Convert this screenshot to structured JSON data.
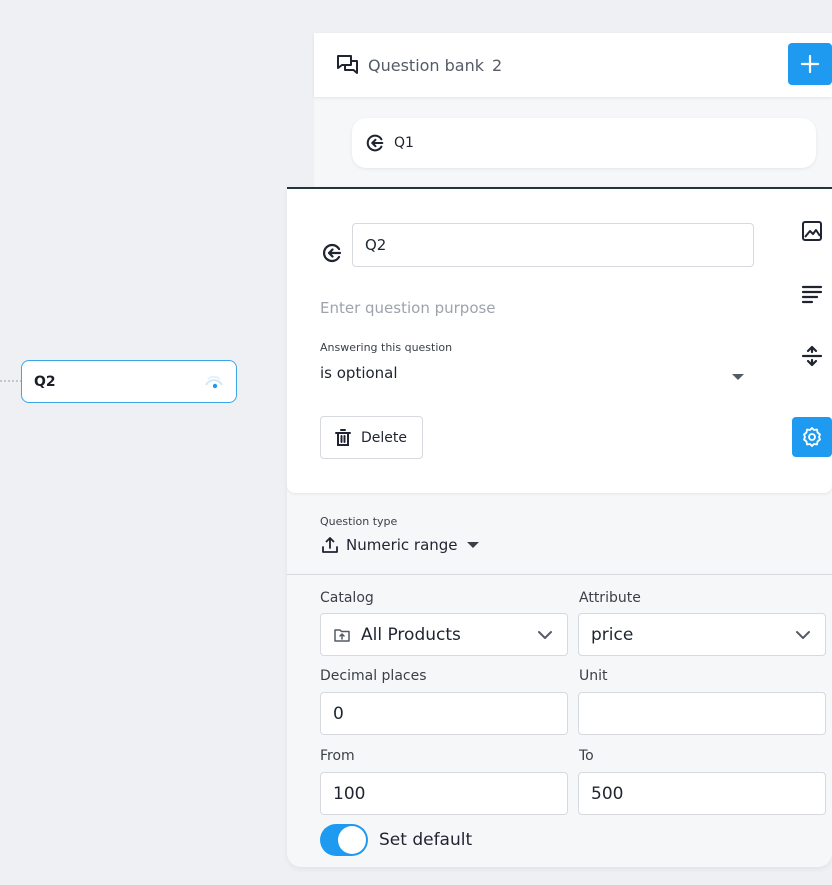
{
  "canvas": {
    "node_label": "Q2"
  },
  "question_bank": {
    "title": "Question bank",
    "count": "2",
    "items": [
      {
        "label": "Q1"
      }
    ]
  },
  "editor": {
    "question_name": "Q2",
    "purpose_placeholder": "Enter question purpose",
    "answer_label": "Answering this question",
    "answer_value": "is optional",
    "delete_label": "Delete",
    "question_type_label": "Question type",
    "question_type_value": "Numeric range",
    "catalog_label": "Catalog",
    "catalog_value": "All Products",
    "attribute_label": "Attribute",
    "attribute_value": "price",
    "decimal_label": "Decimal places",
    "decimal_value": "0",
    "unit_label": "Unit",
    "unit_value": "",
    "from_label": "From",
    "from_value": "100",
    "to_label": "To",
    "to_value": "500",
    "set_default_label": "Set default",
    "set_default_on": true
  },
  "icons": {
    "bank": "chat-bubbles-icon",
    "add": "plus-icon",
    "question": "arrow-left-circle-icon",
    "image_tool": "image-icon",
    "text_tool": "text-align-icon",
    "logic_tool": "branch-icon",
    "settings_tool": "gear-icon",
    "delete": "trash-icon",
    "question_type": "upload-icon",
    "catalog": "folder-upload-icon"
  },
  "colors": {
    "accent": "#1e9bf0",
    "node_border": "#3aa6e8",
    "editor_border": "#1f3540"
  }
}
